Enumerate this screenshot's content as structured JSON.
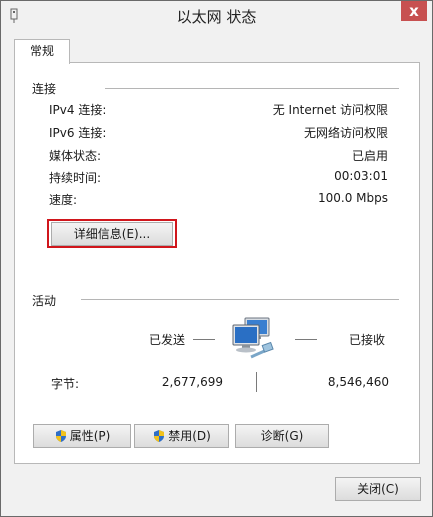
{
  "window": {
    "title": "以太网 状态",
    "close_glyph": "x"
  },
  "tabs": [
    {
      "label": "常规"
    }
  ],
  "connection": {
    "group_title": "连接",
    "rows": [
      {
        "label": "IPv4 连接:",
        "value": "无 Internet 访问权限"
      },
      {
        "label": "IPv6 连接:",
        "value": "无网络访问权限"
      },
      {
        "label": "媒体状态:",
        "value": "已启用"
      },
      {
        "label": "持续时间:",
        "value": "00:03:01"
      },
      {
        "label": "速度:",
        "value": "100.0 Mbps"
      }
    ],
    "details_button": "详细信息(E)..."
  },
  "activity": {
    "group_title": "活动",
    "sent_label": "已发送",
    "received_label": "已接收",
    "bytes_label": "字节:",
    "bytes_sent": "2,677,699",
    "bytes_received": "8,546,460",
    "network_icon": "network-computers-icon"
  },
  "buttons": {
    "properties": "属性(P)",
    "disable": "禁用(D)",
    "diagnose": "诊断(G)",
    "close": "关闭(C)"
  },
  "colors": {
    "highlight_border": "#d0161c",
    "close_button": "#c75050",
    "window_bg": "#f1f1f1"
  }
}
